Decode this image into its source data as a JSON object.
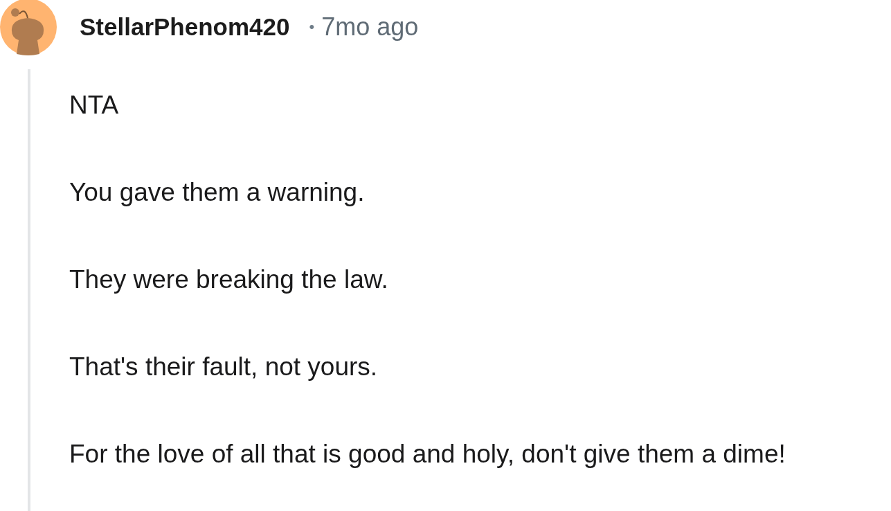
{
  "comment": {
    "author": "StellarPhenom420",
    "separator": "•",
    "time": "7mo ago",
    "paragraphs": [
      "NTA",
      "You gave them a warning.",
      "They were breaking the law.",
      "That's their fault, not yours.",
      "For the love of all that is good and holy, don't give them a dime!"
    ]
  }
}
